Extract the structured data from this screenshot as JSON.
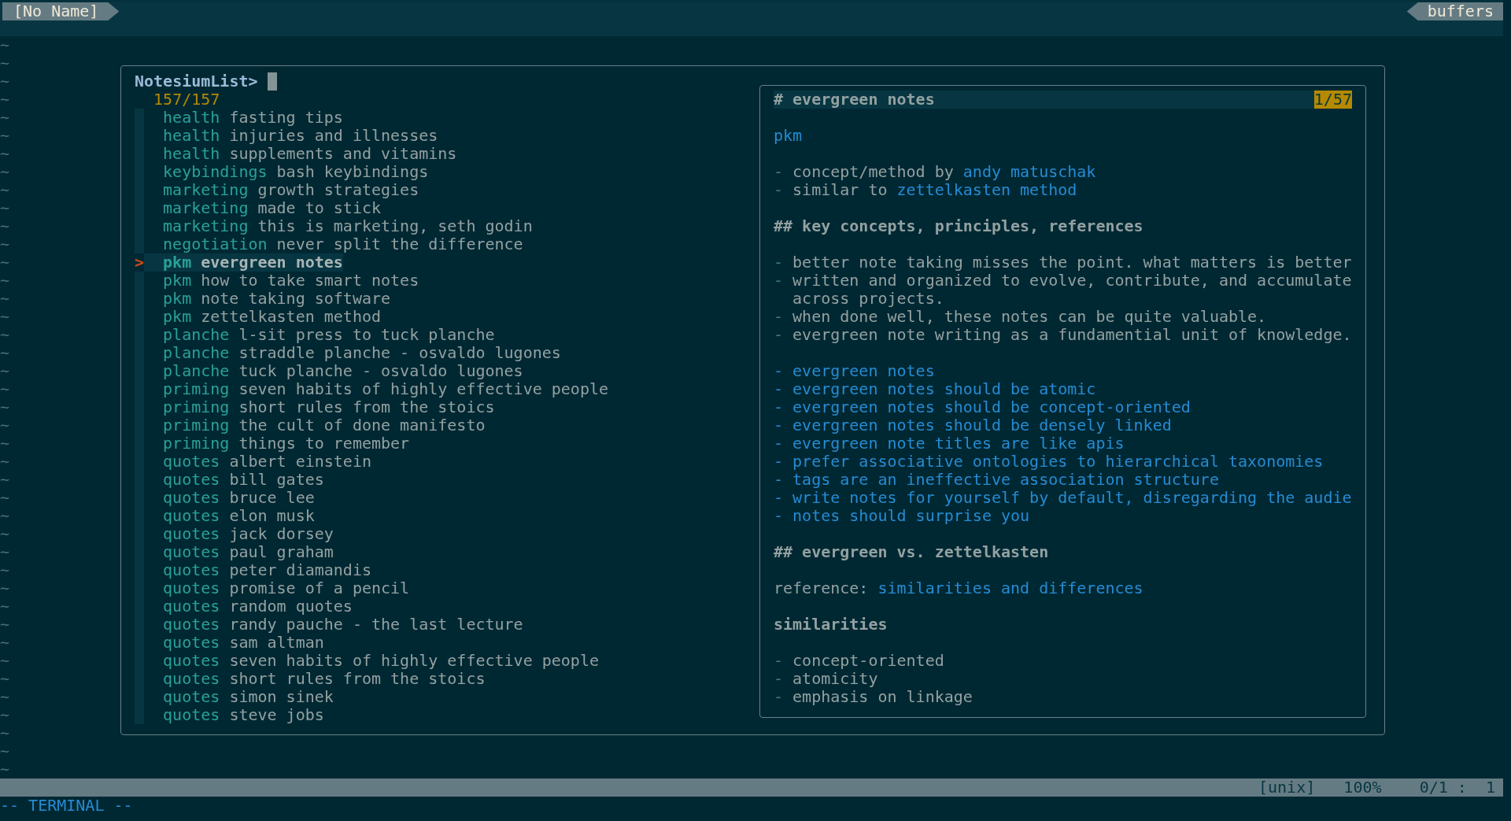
{
  "tabline": {
    "left_tab": "[No Name]",
    "right_tab": "buffers"
  },
  "tildes": [
    "~",
    "~",
    "~",
    "~",
    "~",
    "~",
    "~",
    "~",
    "~",
    "~",
    "~",
    "~",
    "~",
    "~",
    "~",
    "~",
    "~",
    "~",
    "~",
    "~",
    "~",
    "~",
    "~",
    "~",
    "~",
    "~",
    "~",
    "~",
    "~",
    "~",
    "~",
    "~",
    "~",
    "~",
    "~",
    "~",
    "~",
    "~",
    "~",
    "~",
    "~"
  ],
  "picker": {
    "prompt": "NotesiumList>",
    "count": "157/157",
    "pointer": ">",
    "items": [
      {
        "category": "health",
        "title": "fasting tips",
        "selected": false
      },
      {
        "category": "health",
        "title": "injuries and illnesses",
        "selected": false
      },
      {
        "category": "health",
        "title": "supplements and vitamins",
        "selected": false
      },
      {
        "category": "keybindings",
        "title": "bash keybindings",
        "selected": false
      },
      {
        "category": "marketing",
        "title": "growth strategies",
        "selected": false
      },
      {
        "category": "marketing",
        "title": "made to stick",
        "selected": false
      },
      {
        "category": "marketing",
        "title": "this is marketing, seth godin",
        "selected": false
      },
      {
        "category": "negotiation",
        "title": "never split the difference",
        "selected": false
      },
      {
        "category": "pkm",
        "title": "evergreen notes",
        "selected": true
      },
      {
        "category": "pkm",
        "title": "how to take smart notes",
        "selected": false
      },
      {
        "category": "pkm",
        "title": "note taking software",
        "selected": false
      },
      {
        "category": "pkm",
        "title": "zettelkasten method",
        "selected": false
      },
      {
        "category": "planche",
        "title": "l-sit press to tuck planche",
        "selected": false
      },
      {
        "category": "planche",
        "title": "straddle planche - osvaldo lugones",
        "selected": false
      },
      {
        "category": "planche",
        "title": "tuck planche - osvaldo lugones",
        "selected": false
      },
      {
        "category": "priming",
        "title": "seven habits of highly effective people",
        "selected": false
      },
      {
        "category": "priming",
        "title": "short rules from the stoics",
        "selected": false
      },
      {
        "category": "priming",
        "title": "the cult of done manifesto",
        "selected": false
      },
      {
        "category": "priming",
        "title": "things to remember",
        "selected": false
      },
      {
        "category": "quotes",
        "title": "albert einstein",
        "selected": false
      },
      {
        "category": "quotes",
        "title": "bill gates",
        "selected": false
      },
      {
        "category": "quotes",
        "title": "bruce lee",
        "selected": false
      },
      {
        "category": "quotes",
        "title": "elon musk",
        "selected": false
      },
      {
        "category": "quotes",
        "title": "jack dorsey",
        "selected": false
      },
      {
        "category": "quotes",
        "title": "paul graham",
        "selected": false
      },
      {
        "category": "quotes",
        "title": "peter diamandis",
        "selected": false
      },
      {
        "category": "quotes",
        "title": "promise of a pencil",
        "selected": false
      },
      {
        "category": "quotes",
        "title": "random quotes",
        "selected": false
      },
      {
        "category": "quotes",
        "title": "randy pauche - the last lecture",
        "selected": false
      },
      {
        "category": "quotes",
        "title": "sam altman",
        "selected": false
      },
      {
        "category": "quotes",
        "title": "seven habits of highly effective people",
        "selected": false
      },
      {
        "category": "quotes",
        "title": "short rules from the stoics",
        "selected": false
      },
      {
        "category": "quotes",
        "title": "simon sinek",
        "selected": false
      },
      {
        "category": "quotes",
        "title": "steve jobs",
        "selected": false
      }
    ]
  },
  "preview": {
    "title": "# evergreen notes",
    "position": "1/57",
    "blocks": [
      {
        "lines": [
          {
            "kind": "line",
            "segments": [
              {
                "text": "pkm",
                "kind": "link"
              }
            ]
          }
        ]
      },
      {
        "lines": [
          {
            "kind": "line",
            "segments": [
              {
                "text": "-",
                "kind": "marker"
              },
              {
                "text": "concept/method by",
                "kind": "plain"
              },
              {
                "text": "andy matuschak",
                "kind": "link"
              }
            ]
          },
          {
            "kind": "line",
            "segments": [
              {
                "text": "-",
                "kind": "marker"
              },
              {
                "text": "similar to",
                "kind": "plain"
              },
              {
                "text": "zettelkasten method",
                "kind": "link"
              }
            ]
          }
        ]
      },
      {
        "lines": [
          {
            "kind": "line",
            "segments": [
              {
                "text": "## key concepts, principles, references",
                "kind": "heading"
              }
            ]
          }
        ]
      },
      {
        "lines": [
          {
            "kind": "line",
            "segments": [
              {
                "text": "-",
                "kind": "marker"
              },
              {
                "text": "better note taking misses the point. what matters is better",
                "kind": "plain"
              }
            ]
          },
          {
            "kind": "line",
            "segments": [
              {
                "text": "-",
                "kind": "marker"
              },
              {
                "text": "written and organized to evolve, contribute, and accumulate",
                "kind": "plain"
              }
            ]
          },
          {
            "kind": "wrap",
            "segments": [
              {
                "text": "across projects.",
                "kind": "plain"
              }
            ]
          },
          {
            "kind": "line",
            "segments": [
              {
                "text": "-",
                "kind": "marker"
              },
              {
                "text": "when done well, these notes can be quite valuable.",
                "kind": "plain"
              }
            ]
          },
          {
            "kind": "line",
            "segments": [
              {
                "text": "-",
                "kind": "marker"
              },
              {
                "text": "evergreen note writing as a fundamential unit of knowledge.",
                "kind": "plain"
              }
            ]
          }
        ]
      },
      {
        "lines": [
          {
            "kind": "line",
            "segments": [
              {
                "text": "- evergreen notes",
                "kind": "link"
              }
            ]
          },
          {
            "kind": "line",
            "segments": [
              {
                "text": "- evergreen notes should be atomic",
                "kind": "link"
              }
            ]
          },
          {
            "kind": "line",
            "segments": [
              {
                "text": "- evergreen notes should be concept-oriented",
                "kind": "link"
              }
            ]
          },
          {
            "kind": "line",
            "segments": [
              {
                "text": "- evergreen notes should be densely linked",
                "kind": "link"
              }
            ]
          },
          {
            "kind": "line",
            "segments": [
              {
                "text": "- evergreen note titles are like apis",
                "kind": "link"
              }
            ]
          },
          {
            "kind": "line",
            "segments": [
              {
                "text": "- prefer associative ontologies to hierarchical taxonomies",
                "kind": "link"
              }
            ]
          },
          {
            "kind": "line",
            "segments": [
              {
                "text": "- tags are an ineffective association structure",
                "kind": "link"
              }
            ]
          },
          {
            "kind": "line",
            "segments": [
              {
                "text": "- write notes for yourself by default, disregarding the audie",
                "kind": "link"
              }
            ]
          },
          {
            "kind": "line",
            "segments": [
              {
                "text": "- notes should surprise you",
                "kind": "link"
              }
            ]
          }
        ]
      },
      {
        "lines": [
          {
            "kind": "line",
            "segments": [
              {
                "text": "## evergreen vs. zettelkasten",
                "kind": "heading"
              }
            ]
          }
        ]
      },
      {
        "lines": [
          {
            "kind": "line",
            "segments": [
              {
                "text": "reference:",
                "kind": "plain"
              },
              {
                "text": "similarities and differences",
                "kind": "link"
              }
            ]
          }
        ]
      },
      {
        "lines": [
          {
            "kind": "line",
            "segments": [
              {
                "text": "similarities",
                "kind": "heading"
              }
            ]
          }
        ]
      },
      {
        "lines": [
          {
            "kind": "line",
            "segments": [
              {
                "text": "-",
                "kind": "marker"
              },
              {
                "text": "concept-oriented",
                "kind": "plain"
              }
            ]
          },
          {
            "kind": "line",
            "segments": [
              {
                "text": "-",
                "kind": "marker"
              },
              {
                "text": "atomicity",
                "kind": "plain"
              }
            ]
          },
          {
            "kind": "line",
            "segments": [
              {
                "text": "-",
                "kind": "marker"
              },
              {
                "text": "emphasis on linkage",
                "kind": "plain"
              }
            ]
          }
        ]
      }
    ]
  },
  "status_bar": {
    "format": "[unix]",
    "percent": "100%",
    "position": "0/1 :  1"
  },
  "mode": "-- TERMINAL --"
}
